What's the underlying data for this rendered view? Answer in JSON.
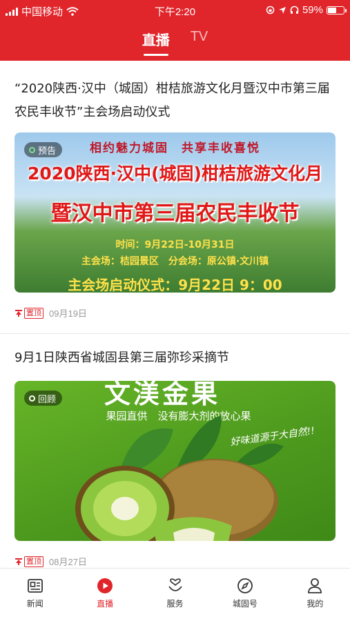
{
  "status_bar": {
    "carrier": "中国移动",
    "time": "下午2:20",
    "battery": "59%",
    "battery_fraction": 0.59
  },
  "top_tabs": [
    {
      "label": "直播",
      "active": true
    },
    {
      "label": "TV",
      "active": false
    }
  ],
  "feed": [
    {
      "title": "“2020陕西·汉中（城固）柑桔旅游文化月暨汉中市第三届农民丰收节”主会场启动仪式",
      "badge": "预告",
      "poster": {
        "slogan": "相约魅力城固　共享丰收喜悦",
        "line1": "2020陕西·汉中(城固)柑桔旅游文化月",
        "line2": "暨汉中市第三届农民丰收节",
        "time": "时间：9月22日-10月31日",
        "venues": "主会场：桔园景区　分会场：原公镇·文川镇",
        "ceremony": "主会场启动仪式：9月22日 9：00"
      },
      "pinned": "置顶",
      "date": "09月19日"
    },
    {
      "title": "9月1日陕西省城固县第三届弥珍采摘节",
      "badge": "回顾",
      "poster": {
        "brand": "文渼金果",
        "sub": "果园直供　没有膨大剂的放心果",
        "script": "好味道源于大自然!!"
      },
      "pinned": "置顶",
      "date": "08月27日"
    }
  ],
  "tabbar": [
    {
      "label": "新闻",
      "icon": "newspaper-icon",
      "active": false
    },
    {
      "label": "直播",
      "icon": "play-circle-icon",
      "active": true
    },
    {
      "label": "服务",
      "icon": "heart-hand-icon",
      "active": false
    },
    {
      "label": "城固号",
      "icon": "compass-icon",
      "active": false
    },
    {
      "label": "我的",
      "icon": "person-icon",
      "active": false
    }
  ],
  "colors": {
    "brand_red": "#e0252b",
    "badge_green": "#7ee08a"
  }
}
